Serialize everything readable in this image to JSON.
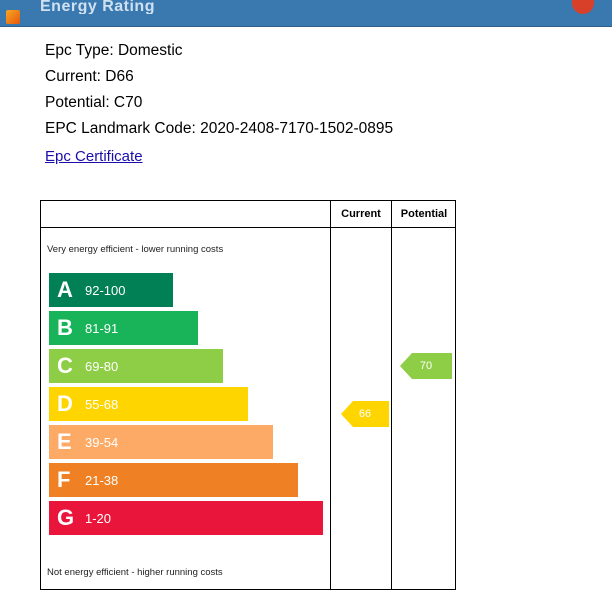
{
  "window": {
    "title": "Energy Rating"
  },
  "info": {
    "type_line": "Epc Type: Domestic",
    "current_line": "Current: D66",
    "potential_line": "Potential: C70",
    "landmark_line": "EPC Landmark Code: 2020-2408-7170-1502-0895",
    "certificate_link": "Epc Certificate"
  },
  "chart": {
    "col_current": "Current",
    "col_potential": "Potential",
    "top_caption": "Very energy efficient - lower running costs",
    "bottom_caption": "Not energy efficient - higher running costs",
    "bands": [
      {
        "letter": "A",
        "range": "92-100",
        "color": "#008054"
      },
      {
        "letter": "B",
        "range": "81-91",
        "color": "#19b459"
      },
      {
        "letter": "C",
        "range": "69-80",
        "color": "#8dce46"
      },
      {
        "letter": "D",
        "range": "55-68",
        "color": "#ffd500"
      },
      {
        "letter": "E",
        "range": "39-54",
        "color": "#fcaa65"
      },
      {
        "letter": "F",
        "range": "21-38",
        "color": "#ef8023"
      },
      {
        "letter": "G",
        "range": "1-20",
        "color": "#e9153b"
      }
    ],
    "current": {
      "value": "66",
      "band": "D",
      "color": "#ffd500"
    },
    "potential": {
      "value": "70",
      "band": "C",
      "color": "#8dce46"
    }
  }
}
